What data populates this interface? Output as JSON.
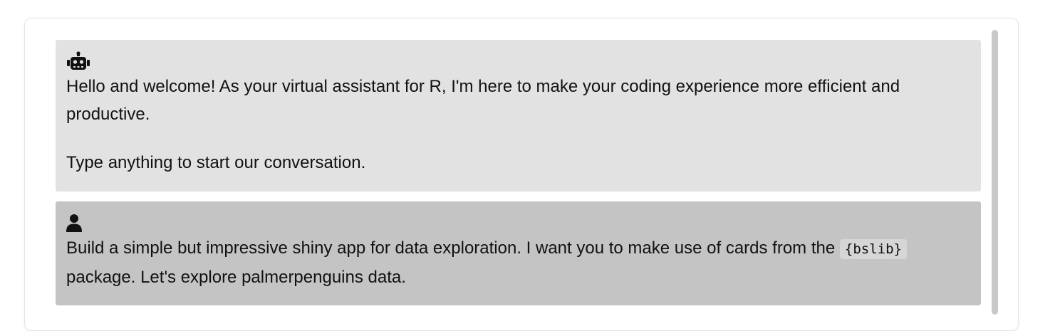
{
  "chat": {
    "messages": [
      {
        "role": "assistant",
        "avatar_icon": "robot-icon",
        "paragraphs": [
          "Hello and welcome! As your virtual assistant for R, I'm here to make your coding experience more efficient and productive.",
          "Type anything to start our conversation."
        ]
      },
      {
        "role": "user",
        "avatar_icon": "user-icon",
        "text_before": "Build a simple but impressive shiny app for data exploration. I want you to make use of cards from the ",
        "code": "{bslib}",
        "text_after": " package. Let's explore palmerpenguins data."
      }
    ]
  },
  "colors": {
    "assistant_bg": "#e2e2e2",
    "user_bg": "#c4c4c4",
    "scrollbar": "#c9c9c9"
  }
}
